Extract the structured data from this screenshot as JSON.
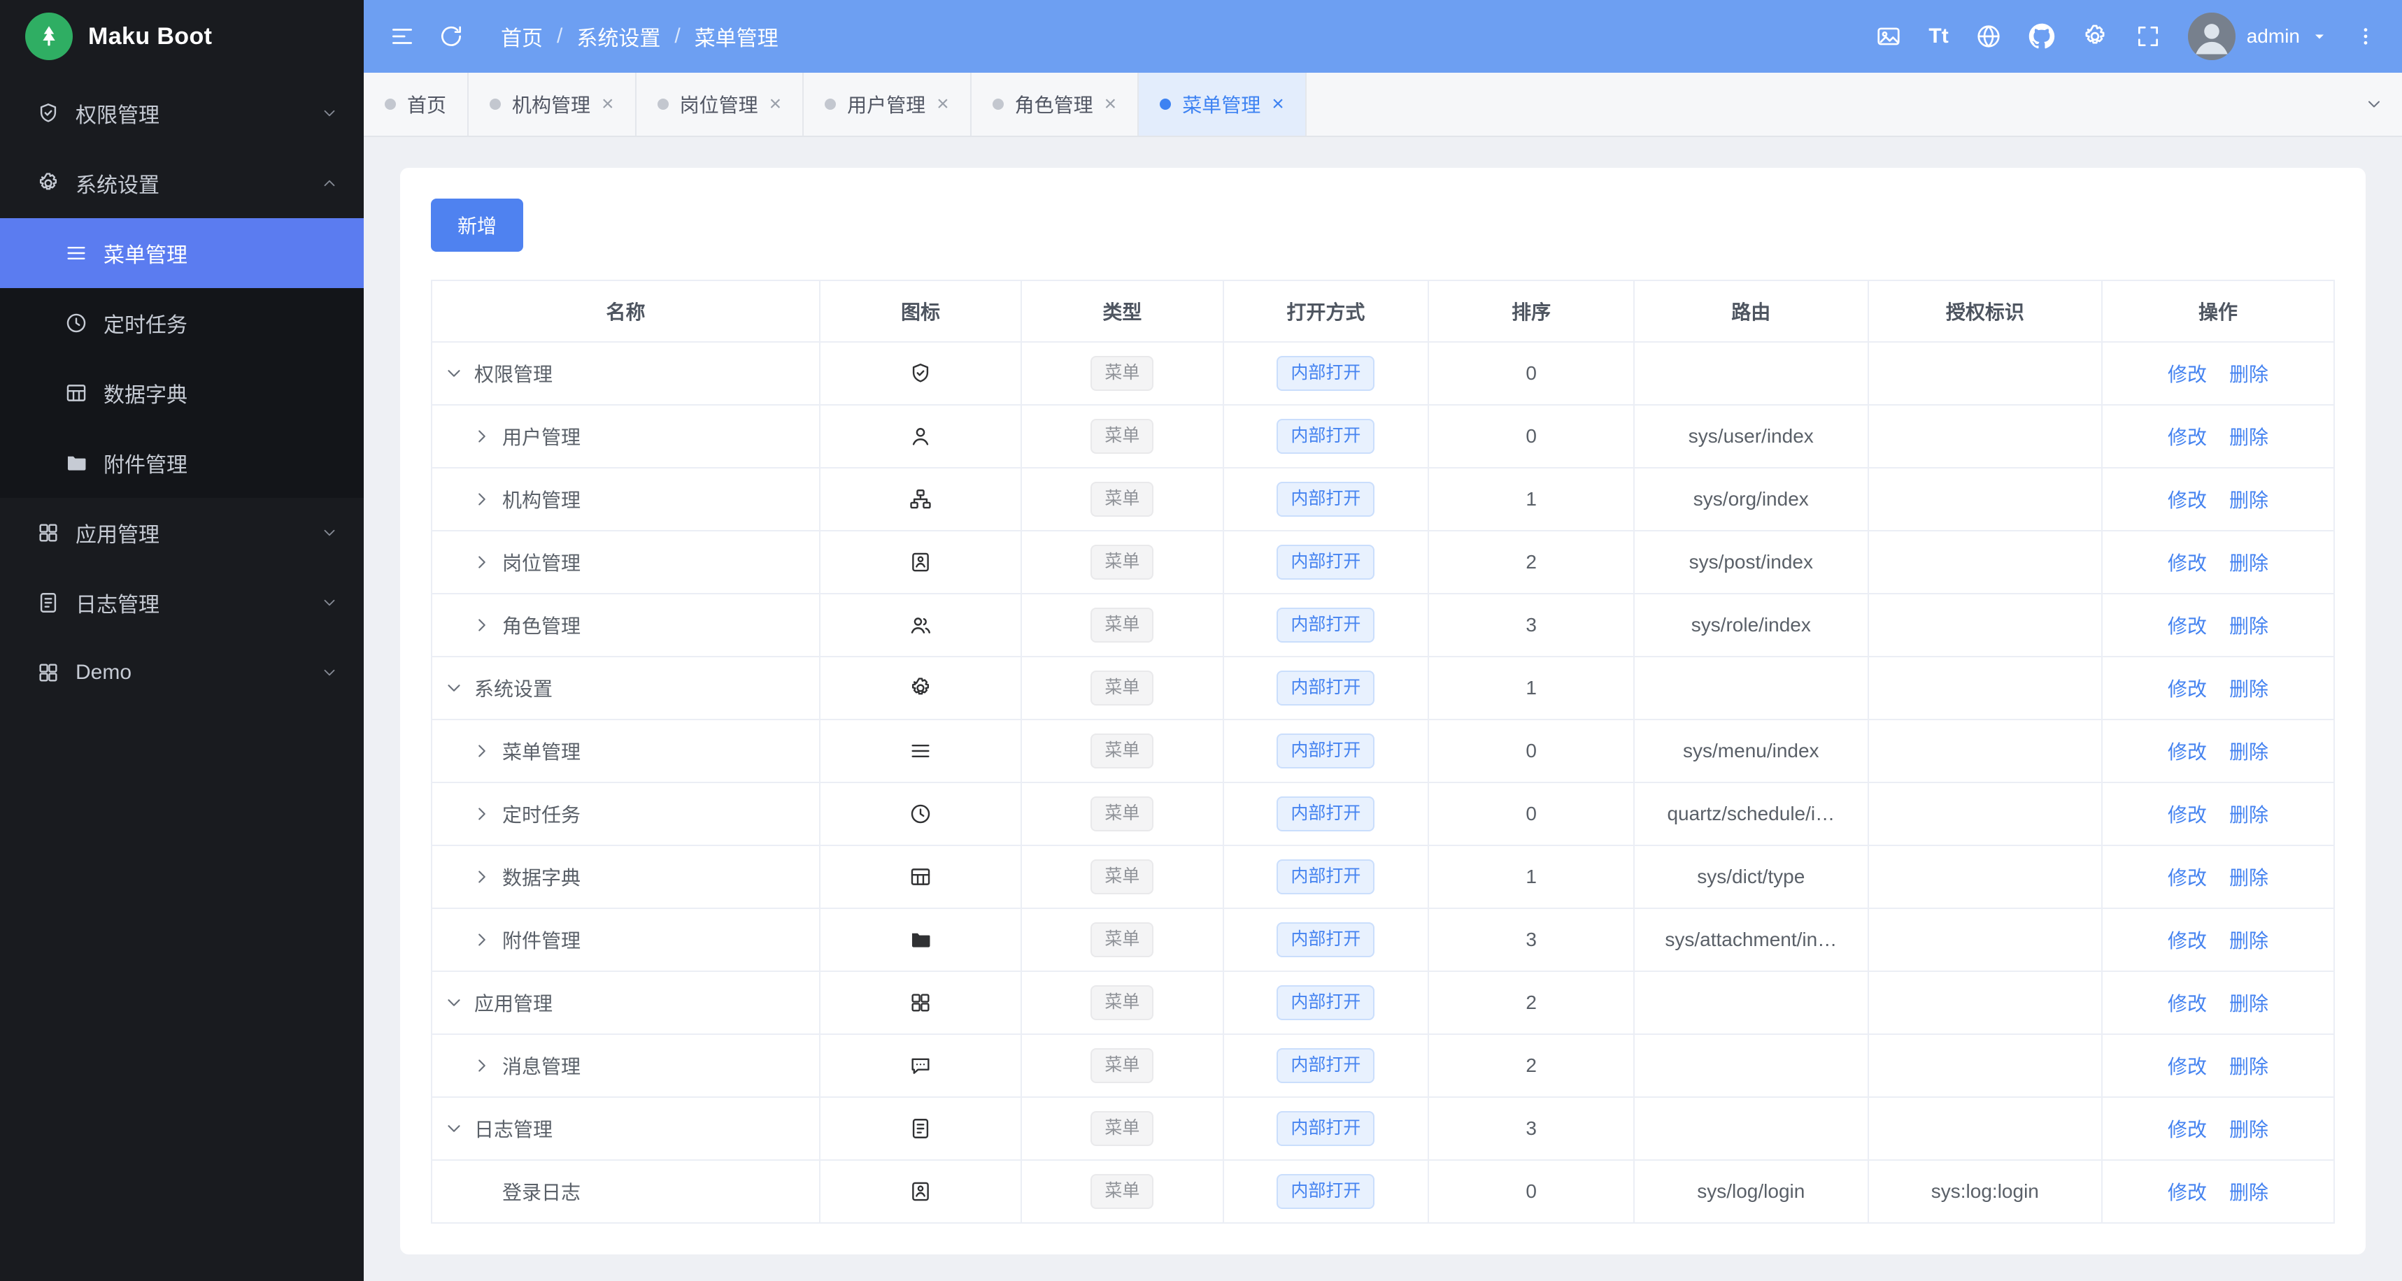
{
  "app": {
    "title": "Maku Boot"
  },
  "colors": {
    "header_blue": "#6d9ff2",
    "sidebar_active_blue": "#5b7cf0",
    "primary_blue": "#4583f0",
    "logo_green": "#2fae63"
  },
  "header": {
    "breadcrumb": [
      "首页",
      "系统设置",
      "菜单管理"
    ],
    "breadcrumb_separator": "/",
    "font_icon_label": "Tt",
    "icons": [
      "fold-icon",
      "refresh-icon",
      "image-icon",
      "font-size-icon",
      "globe-icon",
      "github-icon",
      "theme-gear-icon",
      "fullscreen-icon",
      "kebab-menu-icon"
    ],
    "user": "admin"
  },
  "tabs": [
    {
      "label": "首页",
      "closable": false,
      "active": false
    },
    {
      "label": "机构管理",
      "closable": true,
      "active": false
    },
    {
      "label": "岗位管理",
      "closable": true,
      "active": false
    },
    {
      "label": "用户管理",
      "closable": true,
      "active": false
    },
    {
      "label": "角色管理",
      "closable": true,
      "active": false
    },
    {
      "label": "菜单管理",
      "closable": true,
      "active": true
    }
  ],
  "tab_close_glyph": "×",
  "sidebar": {
    "items": [
      {
        "label": "权限管理",
        "icon": "shield-icon",
        "expanded": false
      },
      {
        "label": "系统设置",
        "icon": "gear-icon",
        "expanded": true,
        "children": [
          {
            "label": "菜单管理",
            "icon": "menu-icon",
            "active": true
          },
          {
            "label": "定时任务",
            "icon": "clock-icon",
            "active": false
          },
          {
            "label": "数据字典",
            "icon": "table-icon",
            "active": false
          },
          {
            "label": "附件管理",
            "icon": "folder-icon",
            "active": false
          }
        ]
      },
      {
        "label": "应用管理",
        "icon": "grid-icon",
        "expanded": false
      },
      {
        "label": "日志管理",
        "icon": "log-icon",
        "expanded": false
      },
      {
        "label": "Demo",
        "icon": "grid-icon",
        "expanded": false
      }
    ]
  },
  "toolbar": {
    "add_label": "新增"
  },
  "table": {
    "headers": [
      "名称",
      "图标",
      "类型",
      "打开方式",
      "排序",
      "路由",
      "授权标识",
      "操作"
    ],
    "type_tag": "菜单",
    "open_tag": "内部打开",
    "actions": {
      "edit": "修改",
      "delete": "删除"
    },
    "rows": [
      {
        "name": "权限管理",
        "level": 0,
        "expand": "open",
        "icon": "shield-icon",
        "sort": "0",
        "route": "",
        "perm": ""
      },
      {
        "name": "用户管理",
        "level": 1,
        "expand": "closed",
        "icon": "user-icon",
        "sort": "0",
        "route": "sys/user/index",
        "perm": ""
      },
      {
        "name": "机构管理",
        "level": 1,
        "expand": "closed",
        "icon": "org-icon",
        "sort": "1",
        "route": "sys/org/index",
        "perm": ""
      },
      {
        "name": "岗位管理",
        "level": 1,
        "expand": "closed",
        "icon": "badge-icon",
        "sort": "2",
        "route": "sys/post/index",
        "perm": ""
      },
      {
        "name": "角色管理",
        "level": 1,
        "expand": "closed",
        "icon": "users-icon",
        "sort": "3",
        "route": "sys/role/index",
        "perm": ""
      },
      {
        "name": "系统设置",
        "level": 0,
        "expand": "open",
        "icon": "gear-icon",
        "sort": "1",
        "route": "",
        "perm": ""
      },
      {
        "name": "菜单管理",
        "level": 1,
        "expand": "closed",
        "icon": "menu-icon",
        "sort": "0",
        "route": "sys/menu/index",
        "perm": ""
      },
      {
        "name": "定时任务",
        "level": 1,
        "expand": "closed",
        "icon": "clock-icon",
        "sort": "0",
        "route": "quartz/schedule/i…",
        "perm": ""
      },
      {
        "name": "数据字典",
        "level": 1,
        "expand": "closed",
        "icon": "table-icon",
        "sort": "1",
        "route": "sys/dict/type",
        "perm": ""
      },
      {
        "name": "附件管理",
        "level": 1,
        "expand": "closed",
        "icon": "folder-icon",
        "sort": "3",
        "route": "sys/attachment/in…",
        "perm": ""
      },
      {
        "name": "应用管理",
        "level": 0,
        "expand": "open",
        "icon": "grid-icon",
        "sort": "2",
        "route": "",
        "perm": ""
      },
      {
        "name": "消息管理",
        "level": 1,
        "expand": "closed",
        "icon": "message-icon",
        "sort": "2",
        "route": "",
        "perm": ""
      },
      {
        "name": "日志管理",
        "level": 0,
        "expand": "open",
        "icon": "log-icon",
        "sort": "3",
        "route": "",
        "perm": ""
      },
      {
        "name": "登录日志",
        "level": 1,
        "expand": "none",
        "icon": "badge-icon",
        "sort": "0",
        "route": "sys/log/login",
        "perm": "sys:log:login"
      }
    ]
  }
}
